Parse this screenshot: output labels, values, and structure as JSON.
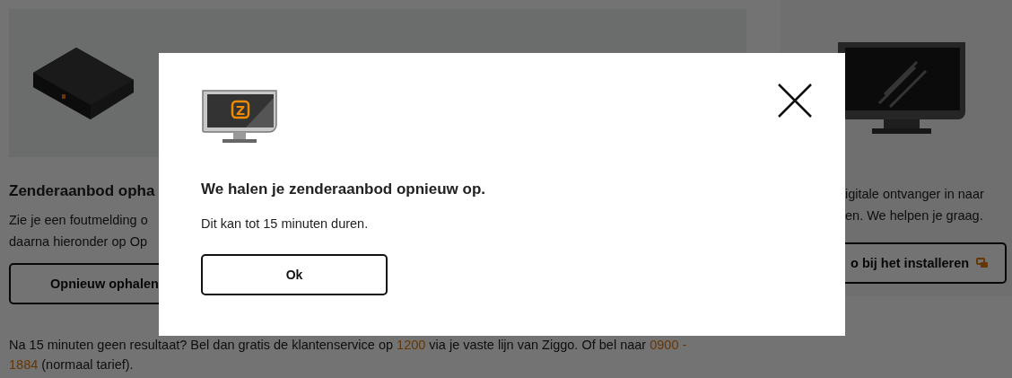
{
  "left": {
    "heading": "Zenderaanbod opha",
    "lines": [
      "Zie je een foutmelding o",
      "daarna hieronder op Op"
    ],
    "button": "Opnieuw ophalen",
    "footer": [
      {
        "kind": "text",
        "text": "Na 15 minuten geen resultaat? Bel dan gratis de klantenservice op "
      },
      {
        "kind": "link",
        "text": "1200"
      },
      {
        "kind": "text",
        "text": " via je vaste lijn van Ziggo. Of bel naar "
      },
      {
        "kind": "link",
        "text": "0900 -"
      },
      {
        "kind": "break-link",
        "text": "1884"
      },
      {
        "kind": "text",
        "text": " (normaal tarief)."
      }
    ]
  },
  "right": {
    "lines": [
      "igitale ontvanger in naar",
      "en. We helpen je graag."
    ],
    "button": "o bij het installeren"
  },
  "modal": {
    "logo": "Z",
    "title": "We halen je zenderaanbod opnieuw op.",
    "text": "Dit kan tot 15 minuten duren.",
    "button": "Ok"
  }
}
